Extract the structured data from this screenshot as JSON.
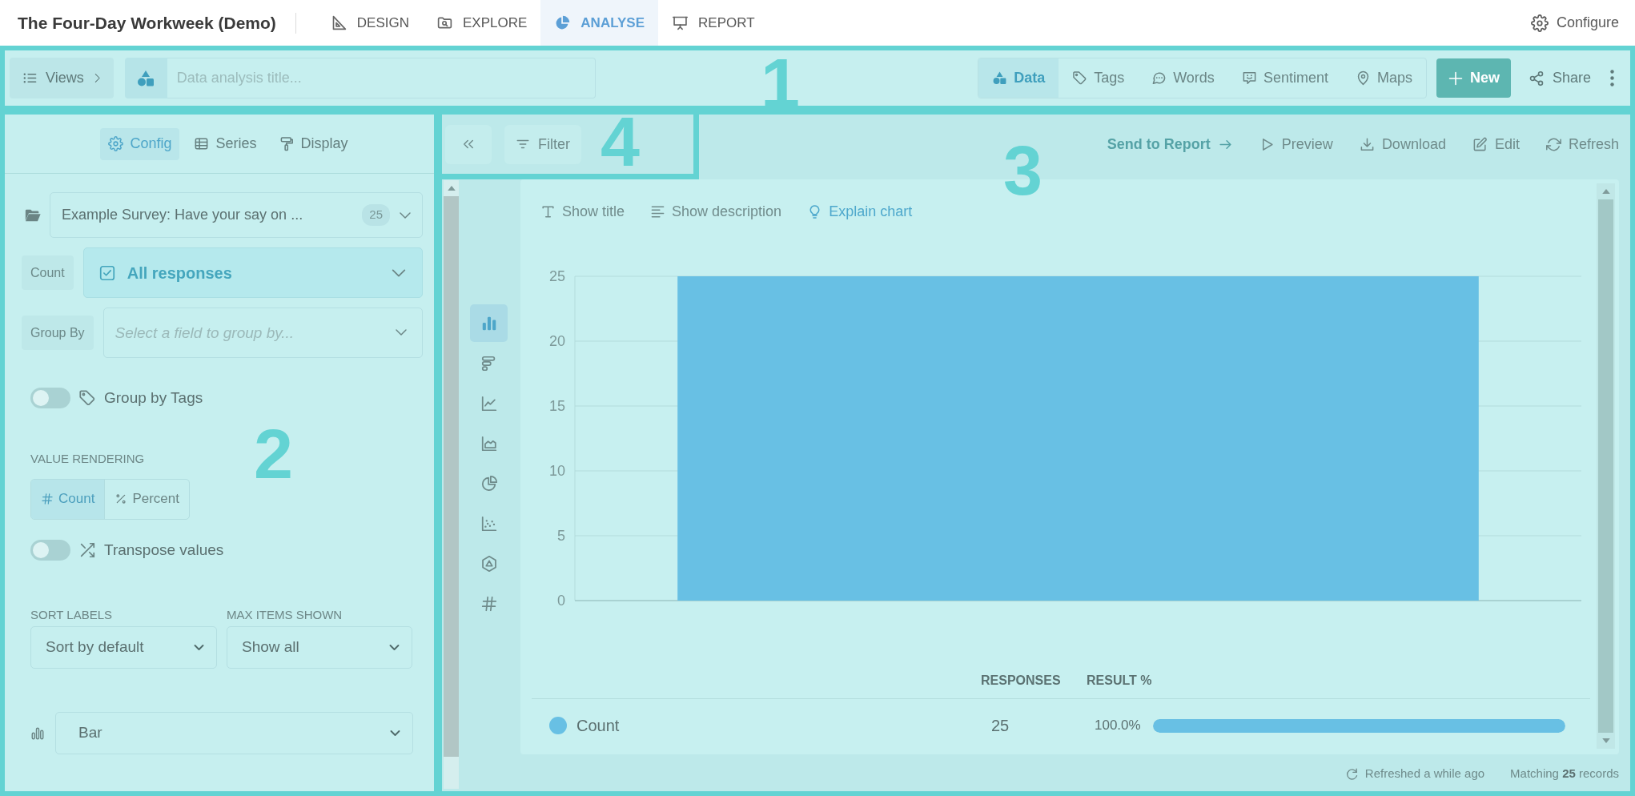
{
  "app_bar": {
    "title": "The Four-Day Workweek (Demo)",
    "nav": [
      {
        "label": "DESIGN",
        "kind": "design",
        "selected": false
      },
      {
        "label": "EXPLORE",
        "kind": "explore",
        "selected": false
      },
      {
        "label": "ANALYSE",
        "kind": "analyse",
        "selected": true
      },
      {
        "label": "REPORT",
        "kind": "report",
        "selected": false
      }
    ],
    "configure": "Configure"
  },
  "toolbar": {
    "annotation": "1",
    "views": "Views",
    "title_placeholder": "Data analysis title...",
    "modes": [
      {
        "label": "Data",
        "kind": "data",
        "selected": true
      },
      {
        "label": "Tags",
        "kind": "tags",
        "selected": false
      },
      {
        "label": "Words",
        "kind": "words",
        "selected": false
      },
      {
        "label": "Sentiment",
        "kind": "sentiment",
        "selected": false
      },
      {
        "label": "Maps",
        "kind": "maps",
        "selected": false
      }
    ],
    "new": "New",
    "share": "Share"
  },
  "config_panel": {
    "annotation": "2",
    "tabs": [
      {
        "label": "Config",
        "kind": "config",
        "selected": true
      },
      {
        "label": "Series",
        "kind": "series",
        "selected": false
      },
      {
        "label": "Display",
        "kind": "display",
        "selected": false
      }
    ],
    "dataset": {
      "value": "Example Survey: Have your say on ...",
      "count": "25"
    },
    "count": {
      "label": "Count",
      "value": "All responses"
    },
    "group_by": {
      "label": "Group By",
      "placeholder": "Select a field to group by..."
    },
    "group_by_tags": {
      "label": "Group by Tags",
      "on": false
    },
    "value_rendering": {
      "label": "VALUE RENDERING",
      "options": [
        {
          "label": "Count",
          "kind": "count",
          "selected": true
        },
        {
          "label": "Percent",
          "kind": "percent",
          "selected": false
        }
      ]
    },
    "transpose": {
      "label": "Transpose values",
      "on": false
    },
    "sort_labels": {
      "label": "SORT LABELS",
      "value": "Sort by default"
    },
    "max_items": {
      "label": "MAX ITEMS SHOWN",
      "value": "Show all"
    },
    "chart_type": {
      "value": "Bar"
    }
  },
  "chart_panel": {
    "annotation": "3",
    "filter_area": {
      "annotation": "4",
      "filter": "Filter"
    },
    "actions": [
      {
        "label": "Send to Report",
        "kind": "send"
      },
      {
        "label": "Preview",
        "kind": "preview"
      },
      {
        "label": "Download",
        "kind": "download"
      },
      {
        "label": "Edit",
        "kind": "edit"
      },
      {
        "label": "Refresh",
        "kind": "refresh"
      }
    ],
    "chart_types": [
      {
        "kind": "bar",
        "selected": true
      },
      {
        "kind": "hbar",
        "selected": false
      },
      {
        "kind": "line",
        "selected": false
      },
      {
        "kind": "area",
        "selected": false
      },
      {
        "kind": "pie",
        "selected": false
      },
      {
        "kind": "scatter",
        "selected": false
      },
      {
        "kind": "hexagon",
        "selected": false
      },
      {
        "kind": "number",
        "selected": false
      }
    ],
    "card": {
      "options": [
        {
          "label": "Show title",
          "kind": "title"
        },
        {
          "label": "Show description",
          "kind": "description"
        },
        {
          "label": "Explain chart",
          "kind": "explain"
        }
      ],
      "chart_data": {
        "type": "bar",
        "values": [
          25
        ],
        "ylim": [
          0,
          25
        ],
        "yticks": [
          0,
          5,
          10,
          15,
          20,
          25
        ],
        "grid": true
      },
      "table": {
        "columns": [
          "RESPONSES",
          "RESULT %"
        ],
        "rows": [
          {
            "label": "Count",
            "color": "#68c0e4",
            "responses": "25",
            "result": "100.0%",
            "level": 1
          }
        ]
      }
    },
    "status": {
      "refreshed": "Refreshed a while ago",
      "matching": "Matching **25** records"
    }
  }
}
